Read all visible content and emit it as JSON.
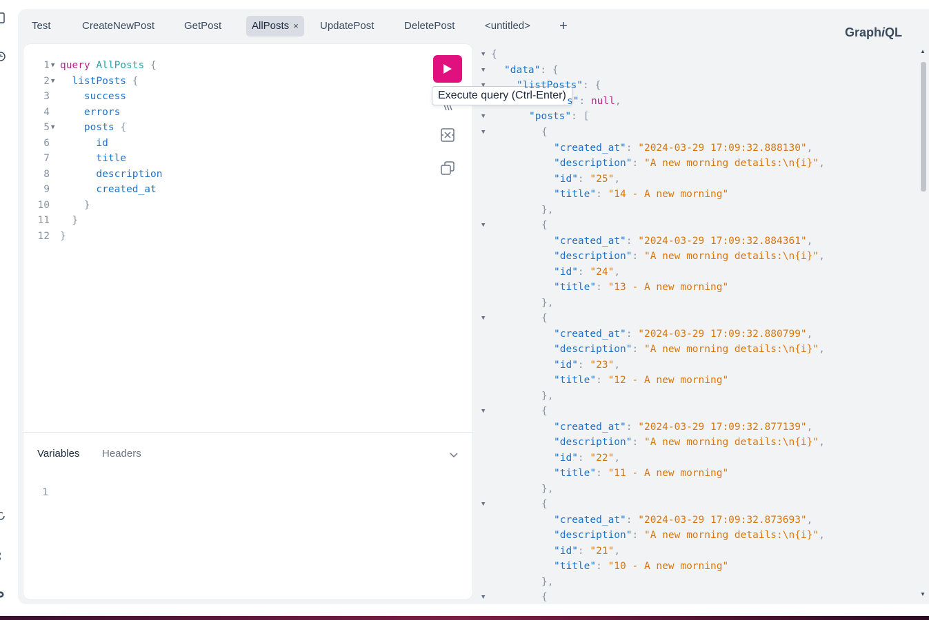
{
  "app": {
    "logo_main": "Graph",
    "logo_i": "i",
    "logo_end": "QL"
  },
  "tabs": [
    {
      "label": "Test"
    },
    {
      "label": "CreateNewPost"
    },
    {
      "label": "GetPost"
    },
    {
      "label": "AllPosts",
      "active": true,
      "close": "×"
    },
    {
      "label": "UpdatePost"
    },
    {
      "label": "DeletePost"
    },
    {
      "label": "<untitled>"
    }
  ],
  "new_tab_label": "+",
  "editor": {
    "line_numbers": [
      "1",
      "2",
      "3",
      "4",
      "5",
      "6",
      "7",
      "8",
      "9",
      "10",
      "11",
      "12"
    ],
    "tokens": {
      "query_kw": "query",
      "op_name": "AllPosts",
      "open_brace": "{",
      "close_brace": "}",
      "list_posts": "listPosts",
      "success": "success",
      "errors": "errors",
      "posts": "posts",
      "id": "id",
      "title": "title",
      "description": "description",
      "created_at": "created_at"
    },
    "execute_tooltip": "Execute query (Ctrl-Enter)"
  },
  "variables_panel": {
    "tab_variables": "Variables",
    "tab_headers": "Headers",
    "line_number": "1"
  },
  "result": {
    "data_key": "\"data\"",
    "list_posts_key": "\"listPosts\"",
    "errors_key_visible": "s\"",
    "null_value": "null",
    "posts_key": "\"posts\"",
    "posts": [
      {
        "created_at": "\"2024-03-29 17:09:32.888130\"",
        "description": "\"A new morning details:\\n{i}\"",
        "id": "\"25\"",
        "title": "\"14 - A new morning\""
      },
      {
        "created_at": "\"2024-03-29 17:09:32.884361\"",
        "description": "\"A new morning details:\\n{i}\"",
        "id": "\"24\"",
        "title": "\"13 - A new morning\""
      },
      {
        "created_at": "\"2024-03-29 17:09:32.880799\"",
        "description": "\"A new morning details:\\n{i}\"",
        "id": "\"23\"",
        "title": "\"12 - A new morning\""
      },
      {
        "created_at": "\"2024-03-29 17:09:32.877139\"",
        "description": "\"A new morning details:\\n{i}\"",
        "id": "\"22\"",
        "title": "\"11 - A new morning\""
      },
      {
        "created_at": "\"2024-03-29 17:09:32.873693\"",
        "description": "\"A new morning details:\\n{i}\"",
        "id": "\"21\"",
        "title": "\"10 - A new morning\""
      }
    ],
    "keys": {
      "created_at": "\"created_at\"",
      "description": "\"description\"",
      "id": "\"id\"",
      "title": "\"title\""
    }
  },
  "colors": {
    "execute_button": "#e0117e",
    "keyword": "#b8248c",
    "string": "#d9770e",
    "field": "#1f71c9",
    "op_name": "#2ba6a6"
  },
  "icons": [
    "prettify-icon",
    "merge-fragments-icon",
    "copy-icon",
    "play-icon",
    "chevron-down-icon"
  ]
}
